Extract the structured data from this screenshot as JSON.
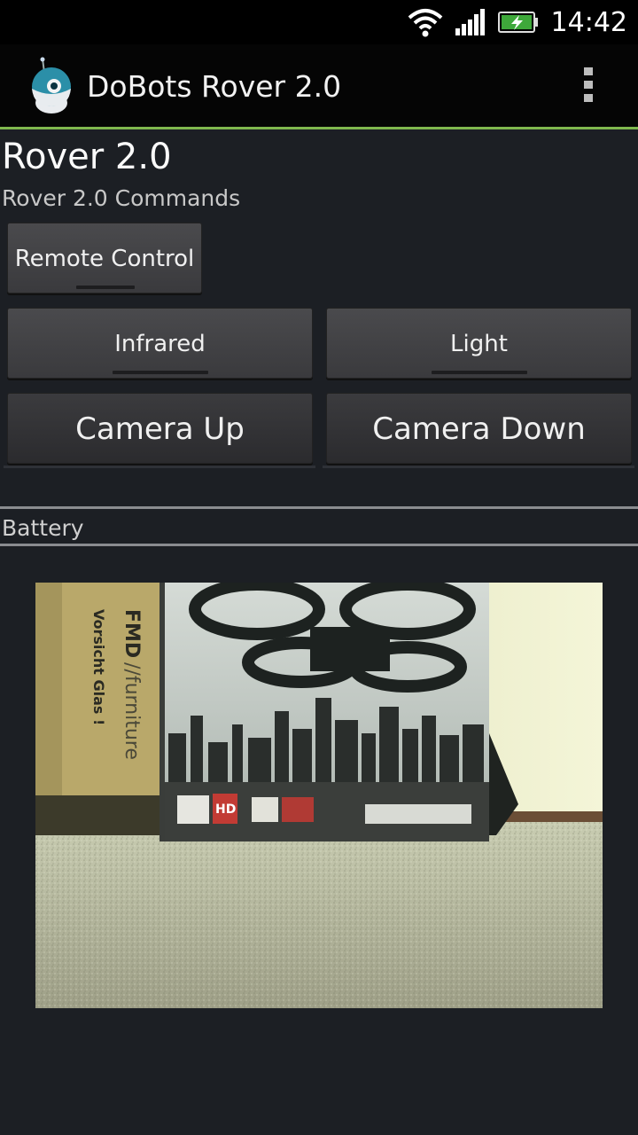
{
  "status_bar": {
    "time": "14:42",
    "icons": [
      "wifi-icon",
      "signal-icon",
      "battery-charging-icon"
    ]
  },
  "action_bar": {
    "app_title": "DoBots Rover 2.0",
    "app_icon": "rover-app-icon",
    "overflow_icon": "overflow-menu-icon",
    "accent_color": "#7fb84e"
  },
  "main": {
    "title": "Rover 2.0",
    "subtitle": "Rover 2.0 Commands",
    "buttons": {
      "remote_control": "Remote Control",
      "infrared": "Infrared",
      "light": "Light",
      "camera_up": "Camera Up",
      "camera_down": "Camera Down"
    },
    "battery_label": "Battery"
  },
  "camera": {
    "box_text_main": "FMD",
    "box_text_brand": "//furniture",
    "box_text_warning": "Vorsicht Glas !",
    "box_badge": "HD"
  }
}
